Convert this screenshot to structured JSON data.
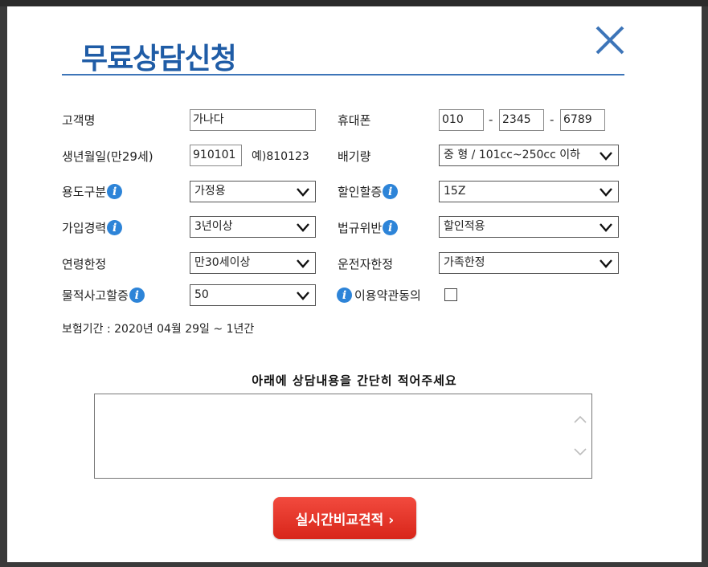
{
  "modal": {
    "title": "무료상담신청"
  },
  "labels": {
    "name": "고객명",
    "phone": "휴대폰",
    "birth": "생년월일(만29세)",
    "birth_example": "예)810123",
    "displacement": "배기량",
    "usage": "용도구분",
    "discount": "할인할증",
    "experience": "가입경력",
    "violation": "법규위반",
    "age_limit": "연령한정",
    "driver_limit": "운전자한정",
    "property_damage": "물적사고할증",
    "terms": "이용약관동의"
  },
  "fields": {
    "name": "가나다",
    "phone1": "010",
    "phone2": "2345",
    "phone3": "6789",
    "birth": "910101",
    "displacement": "중 형 / 101cc~250cc 이하",
    "usage": "가정용",
    "discount": "15Z",
    "experience": "3년이상",
    "violation": "할인적용",
    "age_limit": "만30세이상",
    "driver_limit": "가족한정",
    "property_damage": "50"
  },
  "phone_separator": "-",
  "period": "보험기간 : 2020년 04월 29일 ~ 1년간",
  "memo": {
    "label": "아래에 상담내용을 간단히 적어주세요",
    "value": ""
  },
  "submit": {
    "label": "실시간비교견적 ›"
  },
  "colors": {
    "title": "#1f5ca6",
    "info_icon": "#2d84d8",
    "submit": "#e0301f"
  }
}
